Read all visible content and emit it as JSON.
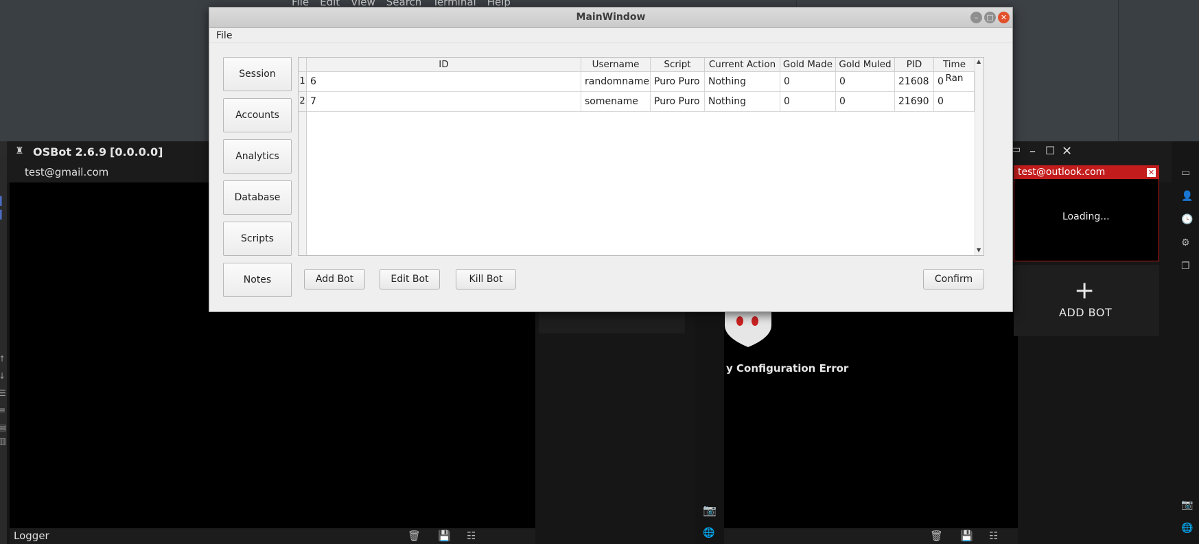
{
  "ide": {
    "menu": [
      "File",
      "Edit",
      "View",
      "Search",
      "Terminal",
      "Help"
    ]
  },
  "osbot": {
    "title": "OSBot 2.6.9",
    "version": "[0.0.0.0]",
    "account": "test@gmail.com",
    "logger_label": "Logger",
    "add_bot_label": "ADD BOT",
    "error_text": "y Configuration Error",
    "session": {
      "email": "test@outlook.com",
      "status": "Loading..."
    }
  },
  "mainwindow": {
    "title": "MainWindow",
    "menu_file": "File",
    "nav": [
      "Session",
      "Accounts",
      "Analytics",
      "Database",
      "Scripts",
      "Notes"
    ],
    "table": {
      "columns": [
        "ID",
        "Username",
        "Script",
        "Current Action",
        "Gold Made",
        "Gold Muled",
        "PID",
        "Time Ran"
      ],
      "rows": [
        {
          "num": "1",
          "id": "6",
          "username": "randomname",
          "script": "Puro Puro",
          "action": "Nothing",
          "gold_made": "0",
          "gold_muled": "0",
          "pid": "21608",
          "time_ran": "0"
        },
        {
          "num": "2",
          "id": "7",
          "username": "somename",
          "script": "Puro Puro",
          "action": "Nothing",
          "gold_made": "0",
          "gold_muled": "0",
          "pid": "21690",
          "time_ran": "0"
        }
      ]
    },
    "buttons": {
      "add_bot": "Add Bot",
      "edit_bot": "Edit Bot",
      "kill_bot": "Kill Bot",
      "confirm": "Confirm"
    }
  },
  "colors": {
    "session_accent": "#c31c1c",
    "client_bg": "#161616",
    "dialog_bg": "#efefef"
  }
}
